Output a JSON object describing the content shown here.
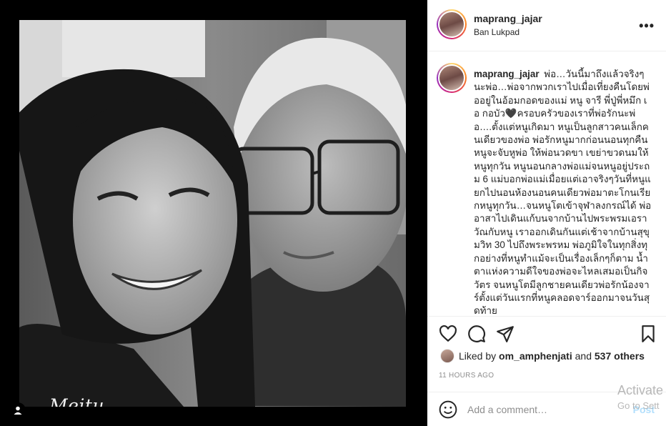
{
  "post": {
    "watermark": "Meitu"
  },
  "header": {
    "username": "maprang_jajar",
    "location": "Ban Lukpad",
    "more_label": "•••"
  },
  "caption": {
    "username": "maprang_jajar",
    "text": "พ่อ…วันนี้มาถึงแล้วจริงๆ นะพ่อ…พ่อจากพวกเราไปเมื่อเที่ยงคืนโดยพ่ออยู่ในอ้อมกอดของแม่ หนู จารี พี่ปู่พี่หมึก เอ กอบัว🖤ครอบครัวของเราที่พ่อรักนะพ่อ….ตั้งแต่หนูเกิดมา หนูเป็นลูกสาวคนเล็กคนเดียวของพ่อ พ่อรักหนูมากก่อนนอนทุกคืนหนูจะจับหูพ่อ ให้พ่อนวดขา เขย่าขวดนมให้หนูทุกวัน หนูนอนกลางพ่อแม่จนหนูอยู่ประถม 6 แม่บอกพ่อแม่เมื่อยแต่เอาจริงๆวันที่หนูแยกไปนอนห้องนอนคนเดียวพ่อมาตะโกนเรียกหนูทุกวัน…จนหนูโตเข้าจุฬาลงกรณ์ได้ พ่ออาสาไปเดินแก้บนจากบ้านไปพระพรมเอราวัณกับหนู เราออกเดินกันแต่เช้าจากบ้านสุขุมวิท 30 ไปถึงพระพรหม พ่อภูมิใจในทุกสิ่งทุกอย่างที่หนูทำแม้จะเป็นเรื่องเล็กๆก็ตาม น้ำตาแห่งความดีใจของพ่อจะไหลเสมอเป็นกิจวัตร จนหนูโตมีลูกชายคนเดียวพ่อรักน้องจาร์ตั้งแต่วันแรกที่หนูคลอดจาร์ออกมาจนวันสุดท้าย"
  },
  "likes": {
    "prefix": "Liked by",
    "user": "om_amphenjati",
    "joiner": "and",
    "others": "537 others"
  },
  "timestamp": "11 HOURS AGO",
  "comment_box": {
    "placeholder": "Add a comment…",
    "post_label": "Post"
  },
  "os_watermark": {
    "line1": "Activate",
    "line2": "Go to Sett"
  },
  "icons": [
    "heart-icon",
    "comment-icon",
    "share-icon",
    "bookmark-icon",
    "emoji-icon",
    "user-tag-icon",
    "more-icon"
  ],
  "colors": {
    "text": "#262626",
    "secondary": "#8e8e8e",
    "post_disabled": "#b2dffc",
    "border": "#efefef"
  }
}
